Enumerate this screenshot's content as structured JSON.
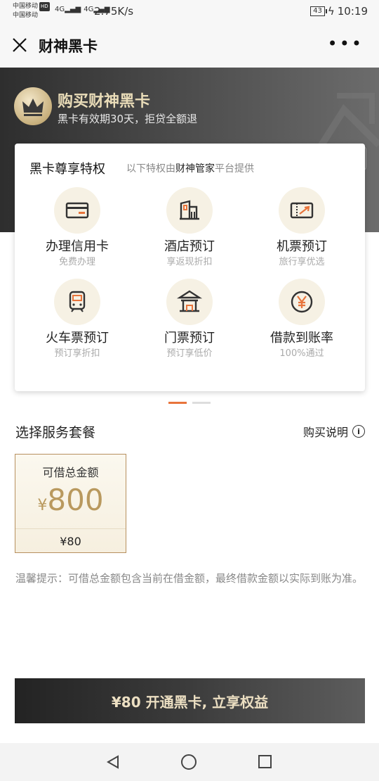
{
  "status_bar": {
    "carrier1": "中国移动",
    "carrier1_badge": "HD",
    "carrier2": "中国移动",
    "signal1": "4G",
    "signal2": "4G",
    "speed": "2.75K/s",
    "battery": "43",
    "time": "10:19"
  },
  "nav": {
    "title": "财神黑卡"
  },
  "banner": {
    "title": "购买财神黑卡",
    "subtitle": "黑卡有效期30天，拒贷全额退"
  },
  "privileges": {
    "title": "黑卡尊享特权",
    "note_prefix": "以下特权由",
    "note_highlight": "财神管家",
    "note_suffix": "平台提供",
    "items": [
      {
        "name": "办理信用卡",
        "desc": "免费办理",
        "icon": "credit-card-icon"
      },
      {
        "name": "酒店预订",
        "desc": "享返现折扣",
        "icon": "hotel-icon"
      },
      {
        "name": "机票预订",
        "desc": "旅行享优选",
        "icon": "flight-ticket-icon"
      },
      {
        "name": "火车票预订",
        "desc": "预订享折扣",
        "icon": "train-icon"
      },
      {
        "name": "门票预订",
        "desc": "预订享低价",
        "icon": "attraction-ticket-icon"
      },
      {
        "name": "借款到账率",
        "desc": "100%通过",
        "icon": "yen-coin-icon"
      }
    ]
  },
  "pager": {
    "pages": 2,
    "active": 0
  },
  "package": {
    "section_title": "选择服务套餐",
    "help_label": "购买说明",
    "card": {
      "label": "可借总金额",
      "currency": "¥",
      "amount": "800",
      "price": "¥80"
    }
  },
  "tip": "温馨提示：可借总金额包含当前在借金额，最终借款金额以实际到账为准。",
  "cta": {
    "label": "¥80 开通黑卡, 立享权益"
  },
  "colors": {
    "accent": "#e8743b",
    "gold": "#b9995e",
    "icon_bg": "#f6f1e4"
  }
}
